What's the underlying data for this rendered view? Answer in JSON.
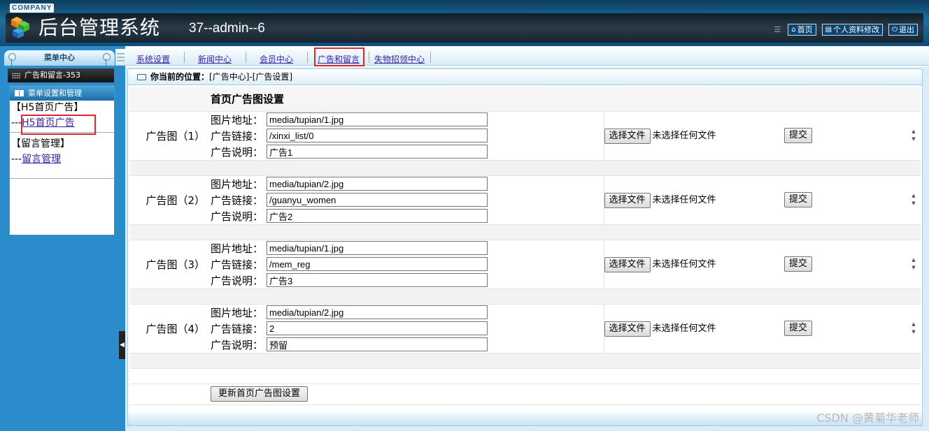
{
  "header": {
    "company": "COMPANY",
    "title": "后台管理系统",
    "user": "37--admin--6",
    "links": [
      {
        "label": "首页",
        "icon": "home-icon"
      },
      {
        "label": "个人资料修改",
        "icon": "document-icon"
      },
      {
        "label": "退出",
        "icon": "power-icon"
      }
    ]
  },
  "sidebar": {
    "menu_center": "菜单中心",
    "section": "广告和留言-353",
    "panel_title": "菜单设置和管理",
    "groups": [
      {
        "title": "【H5首页广告】",
        "prefix": "---",
        "link": "H5首页广告"
      },
      {
        "title": "【留言管理】",
        "prefix": "---",
        "link": "留言管理"
      }
    ]
  },
  "nav": {
    "tabs": [
      "系统设置",
      "新闻中心",
      "会员中心",
      "广告和留言",
      "失物招领中心"
    ],
    "active_index": 3
  },
  "breadcrumb": {
    "label": "你当前的位置：",
    "path": "[广告中心]-[广告设置]"
  },
  "form": {
    "title": "首页广告图设置",
    "field_labels": {
      "image": "图片地址：",
      "link": "广告链接：",
      "desc": "广告说明："
    },
    "file_button": "选择文件",
    "file_status": "未选择任何文件",
    "submit_label": "提交",
    "update_label": "更新首页广告图设置",
    "ads": [
      {
        "label": "广告图（1）",
        "image": "media/tupian/1.jpg",
        "link": "/xinxi_list/0",
        "desc": "广告1"
      },
      {
        "label": "广告图（2）",
        "image": "media/tupian/2.jpg",
        "link": "/guanyu_women",
        "desc": "广告2"
      },
      {
        "label": "广告图（3）",
        "image": "media/tupian/1.jpg",
        "link": "/mem_reg",
        "desc": "广告3"
      },
      {
        "label": "广告图（4）",
        "image": "media/tupian/2.jpg",
        "link": "2",
        "desc": "预留"
      }
    ]
  },
  "watermark": "CSDN @黄菊华老师",
  "colors": {
    "header_bg": "#1c6f9f",
    "sidebar_bg": "#2a8ccb",
    "link": "#3a22a0",
    "highlight_box": "#e0262d"
  }
}
